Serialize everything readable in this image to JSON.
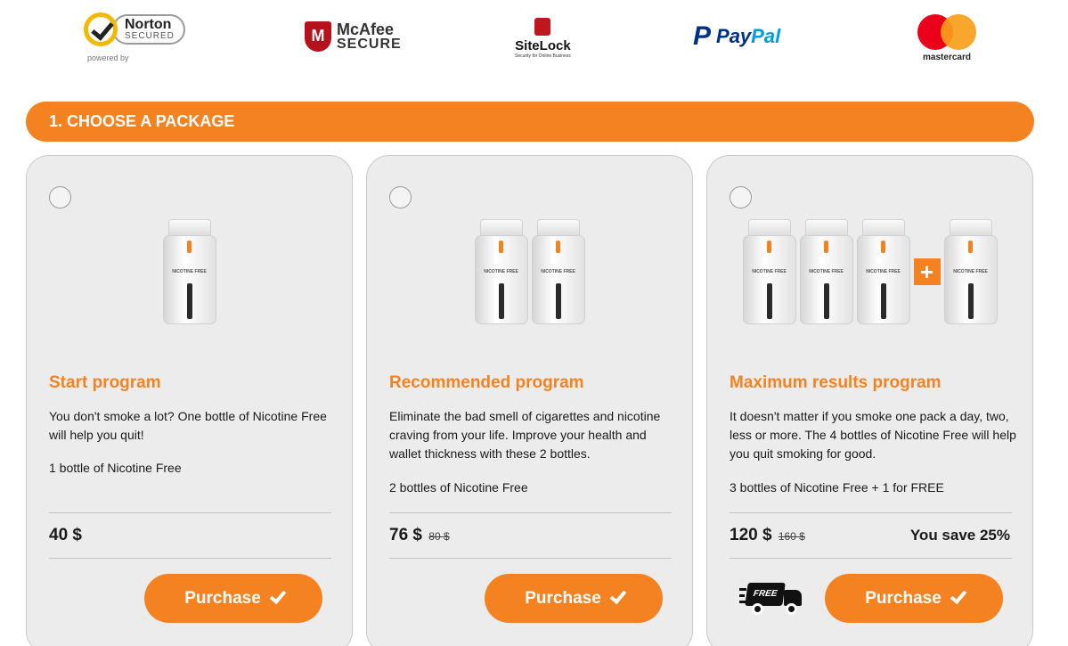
{
  "badges": {
    "norton": {
      "line1": "Norton",
      "line2": "SECURED",
      "powered": "powered by"
    },
    "mcafee": {
      "mark": "M",
      "line1": "McAfee",
      "line2": "SECURE"
    },
    "sitelock": {
      "name": "SiteLock",
      "sub": "Security for Online Business"
    },
    "paypal": {
      "mark": "P",
      "pay": "Pay",
      "pal": "Pal"
    },
    "mastercard": {
      "label": "mastercard"
    }
  },
  "section": {
    "title": "1. CHOOSE A PACKAGE"
  },
  "bottle_label": "NICOTINE FREE",
  "plus_sign": "+",
  "packages": [
    {
      "title": "Start program",
      "description": "You don't smoke a lot? One bottle of Nicotine Free will help you quit!",
      "quantity": "1 bottle of Nicotine Free",
      "price": "40 $",
      "button": "Purchase",
      "bottles": 1
    },
    {
      "title": "Recommended program",
      "description": "Eliminate the bad smell of cigarettes and nicotine craving from your life. Improve your health and wallet thickness with these 2 bottles.",
      "quantity": "2 bottles of Nicotine Free",
      "price": "76 $",
      "old_price": "80 $",
      "button": "Purchase",
      "bottles": 2
    },
    {
      "title": "Maximum results program",
      "description": "It doesn't matter if you smoke one pack a day, two, less or more. The 4 bottles of Nicotine Free will help you quit smoking for good.",
      "quantity": "3 bottles of Nicotine Free + 1 for FREE",
      "price": "120 $",
      "old_price": "160 $",
      "savings": "You save 25%",
      "button": "Purchase",
      "bottles": 4,
      "truck_label": "FREE"
    }
  ],
  "colors": {
    "accent": "#f58220",
    "card_bg": "#ececec"
  }
}
